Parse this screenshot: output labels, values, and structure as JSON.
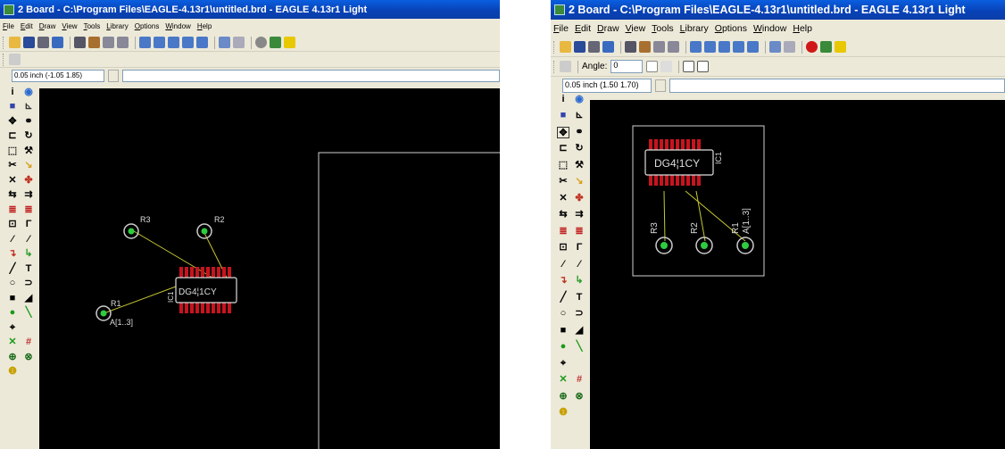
{
  "windowA": {
    "title": "2 Board - C:\\Program Files\\EAGLE-4.13r1\\untitled.brd - EAGLE 4.13r1 Light",
    "menu": [
      "File",
      "Edit",
      "Draw",
      "View",
      "Tools",
      "Library",
      "Options",
      "Window",
      "Help"
    ],
    "coordinate": "0.05 inch (-1.05 1.85)",
    "labels": {
      "r3": "R3",
      "r2": "R2",
      "r1": "R1",
      "ic1": "IC1",
      "chip": "DG4¦1CY",
      "signal": "A[1..3]"
    }
  },
  "windowB": {
    "title": "2 Board - C:\\Program Files\\EAGLE-4.13r1\\untitled.brd - EAGLE 4.13r1 Light",
    "menu": [
      "File",
      "Edit",
      "Draw",
      "View",
      "Tools",
      "Library",
      "Options",
      "Window",
      "Help"
    ],
    "angle_label": "Angle:",
    "angle_value": "0",
    "coordinate": "0.05 inch (1.50 1.70)",
    "labels": {
      "r3": "R3",
      "r2": "R2",
      "r1": "R1",
      "ic1": "IC1",
      "chip": "DG4¦1CY",
      "signal": "A[1..3]"
    }
  },
  "colors": {
    "canvas": "#000000",
    "pad": "#2ecc40",
    "ic_pins": "#c8141e",
    "airwire": "#c8c832",
    "outline": "#d0d0d0"
  }
}
